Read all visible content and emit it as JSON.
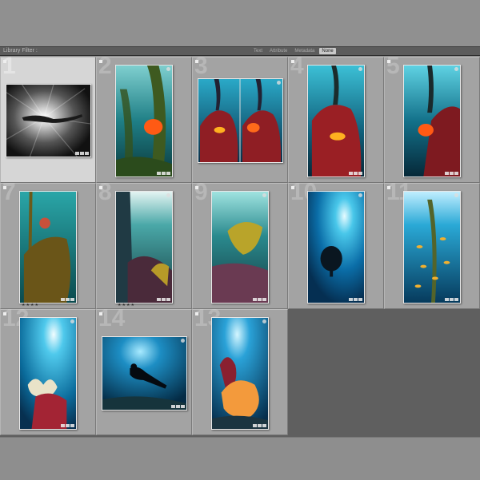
{
  "filter_bar": {
    "title": "Library Filter :",
    "options": [
      "Text",
      "Attribute",
      "Metadata",
      "None"
    ],
    "active": "None"
  },
  "cells": [
    {
      "number": "1",
      "stars": ""
    },
    {
      "number": "2",
      "stars": ""
    },
    {
      "number": "3",
      "stars": ""
    },
    {
      "number": "4",
      "stars": ""
    },
    {
      "number": "5",
      "stars": ""
    },
    {
      "number": "7",
      "stars": "★★★★"
    },
    {
      "number": "8",
      "stars": "★★★★"
    },
    {
      "number": "9",
      "stars": ""
    },
    {
      "number": "10",
      "stars": ""
    },
    {
      "number": "11",
      "stars": ""
    },
    {
      "number": "12",
      "stars": ""
    },
    {
      "number": "14",
      "stars": ""
    },
    {
      "number": "13",
      "stars": ""
    }
  ],
  "colors": {
    "ocean_deep": "#06304a",
    "ocean_light": "#2fb3d4",
    "coral_red": "#b2282c",
    "fish_orange": "#ff6a1a",
    "sea_fan_orange": "#f39a3c"
  }
}
